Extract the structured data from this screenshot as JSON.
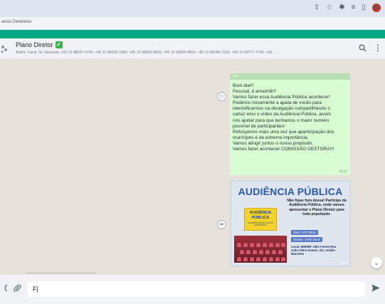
{
  "browser": {
    "bookmark": "anos Diretores",
    "profile_letter": "G"
  },
  "chat": {
    "title": "Plano Diretor",
    "title_badge": "✓",
    "members": "André, Carol, Gi, Giovanni, +55 12 98227-4742, +55 12 99102-1666, +55 12 99602-9693, +55 12 99620-4563, +55 12 99780-7233, +55 12 99777-7742, +55 ..."
  },
  "message": {
    "tag": "1:46",
    "lines": [
      "Bom dia!!!",
      "Pessoal, é amanhã!!!",
      "Vamos fazer essa Audiência Pública acontecer!",
      "Pedimos novamente a ajuda de vocês para",
      "intensificarmos na divulgação compartilhando o",
      "cartaz e/ou o vídeo da Audiência Pública, assim",
      "nos ajudar para que tenhamos o maior numero",
      "possível de participantes!",
      "Reforçamos mais uma vez que aparticipação dos",
      "munícipes é de extrema importância.",
      "Vamos atingir juntos o nosso propósito.",
      "Vamos fazer acontecer COMISSÃO GESTORA!!!"
    ],
    "time": "08:33"
  },
  "poster": {
    "title": "AUDIÊNCIA PÚBLICA",
    "subtitle": "Não fique fora dessa! Participe da Audiência Pública, onde vamos apresentar o Plano Diretor para toda população.",
    "box_title": "AUDIÊNCIA PÚBLICA",
    "box_subtitle": "SUA PARTICIPAÇÃO É MUITO IMPORTANTE",
    "date": "Data: 07/07/2022",
    "hour": "Horário: 19:00 horas",
    "location": "Local: EMEIEF Júlio Fortes Rua João Vieira Soares, s/n, Jardim Marcinex",
    "time": "08:33"
  },
  "input": {
    "value": "F|"
  }
}
